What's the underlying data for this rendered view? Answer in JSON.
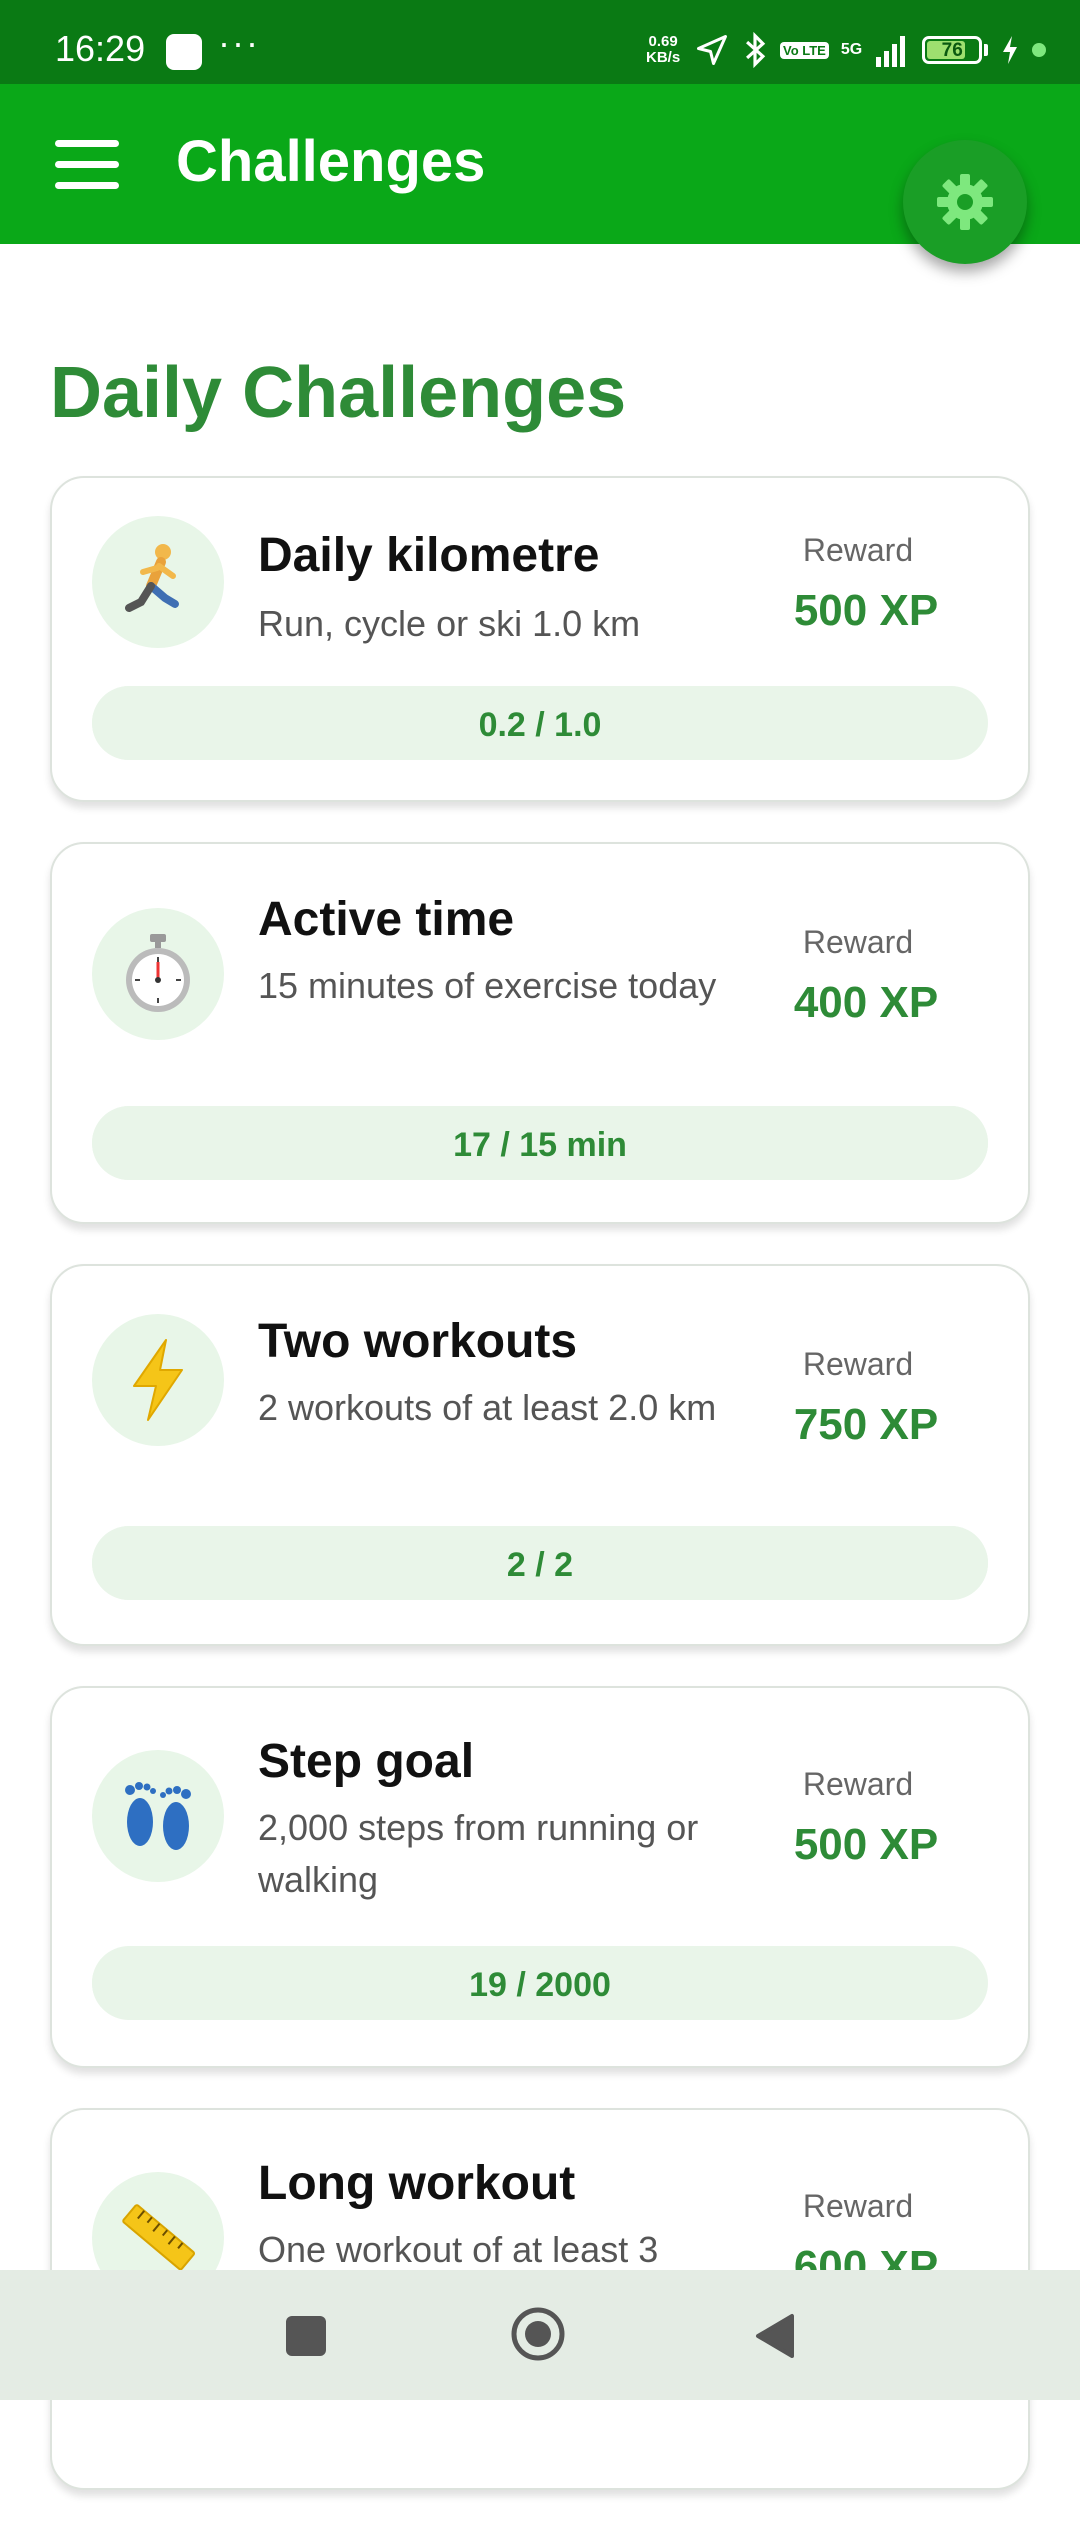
{
  "status_bar": {
    "time": "16:29",
    "more": "···",
    "speed_value": "0.69",
    "speed_unit": "KB/s",
    "volte": "Vo LTE",
    "network": "5G",
    "battery": "76",
    "battery_level": 0.76
  },
  "header": {
    "title": "Challenges",
    "menu_icon": "hamburger-menu-icon",
    "settings_icon": "gear-icon"
  },
  "section": {
    "title": "Daily Challenges"
  },
  "challenges": [
    {
      "icon": "runner-icon",
      "title": "Daily kilometre",
      "description": "Run, cycle or ski 1.0 km",
      "reward_label": "Reward",
      "reward": "500 XP",
      "progress_text": "0.2 / 1.0",
      "progress": 0.2
    },
    {
      "icon": "stopwatch-icon",
      "title": "Active time",
      "description": "15 minutes of exercise today",
      "reward_label": "Reward",
      "reward": "400 XP",
      "progress_text": "17 / 15 min",
      "progress": 1.0
    },
    {
      "icon": "lightning-icon",
      "title": "Two workouts",
      "description": "2 workouts of at least 2.0 km",
      "reward_label": "Reward",
      "reward": "750 XP",
      "progress_text": "2 / 2",
      "progress": 1.0
    },
    {
      "icon": "footprints-icon",
      "title": "Step goal",
      "description": "2,000 steps from running or walking",
      "reward_label": "Reward",
      "reward": "500 XP",
      "progress_text": "19 / 2000",
      "progress": 0.0095
    },
    {
      "icon": "ruler-icon",
      "title": "Long workout",
      "description": "One workout of at least 3",
      "reward_label": "Reward",
      "reward": "600 XP"
    }
  ],
  "nav": {
    "recents_icon": "recents-square-icon",
    "home_icon": "home-circle-icon",
    "back_icon": "back-triangle-icon"
  }
}
